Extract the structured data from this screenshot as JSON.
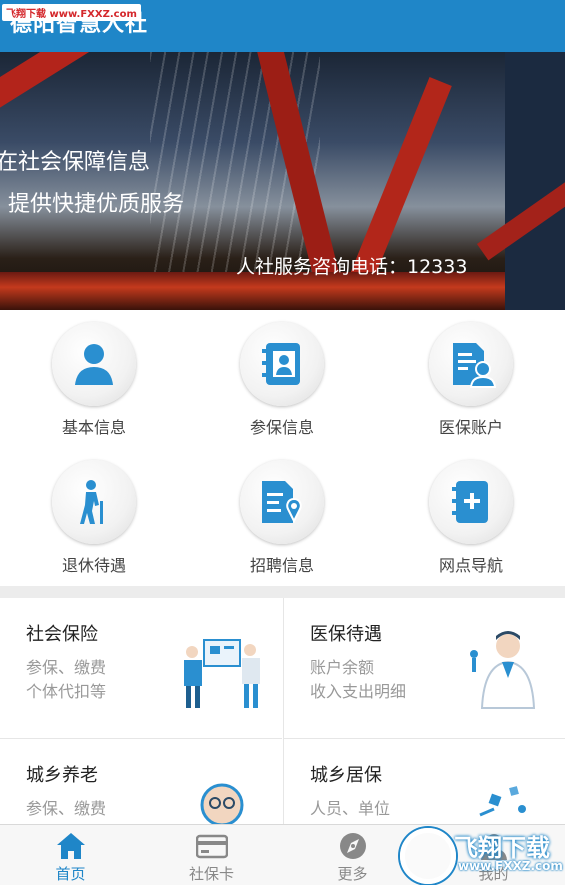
{
  "header": {
    "title": "德阳智慧人社",
    "watermark": "飞翔下载 www.FXXZ.com"
  },
  "banner": {
    "line1": "在社会保障信息",
    "line2": "提供快捷优质服务",
    "hotline": "人社服务咨询电话：12333"
  },
  "grid": [
    {
      "label": "基本信息",
      "icon": "person-icon"
    },
    {
      "label": "参保信息",
      "icon": "contact-book-icon"
    },
    {
      "label": "医保账户",
      "icon": "medical-account-icon"
    },
    {
      "label": "退休待遇",
      "icon": "elder-cane-icon"
    },
    {
      "label": "招聘信息",
      "icon": "document-location-icon"
    },
    {
      "label": "网点导航",
      "icon": "notebook-plus-icon"
    }
  ],
  "cards": [
    {
      "title": "社会保险",
      "sub1": "参保、缴费",
      "sub2": "个体代扣等"
    },
    {
      "title": "医保待遇",
      "sub1": "账户余额",
      "sub2": "收入支出明细"
    },
    {
      "title": "城乡养老",
      "sub1": "参保、缴费",
      "sub2": ""
    },
    {
      "title": "城乡居保",
      "sub1": "人员、单位",
      "sub2": ""
    }
  ],
  "tabs": [
    {
      "label": "首页",
      "icon": "home-icon"
    },
    {
      "label": "社保卡",
      "icon": "card-icon"
    },
    {
      "label": "更多",
      "icon": "compass-icon"
    },
    {
      "label": "我的",
      "icon": "user-icon"
    }
  ],
  "watermark_logo": {
    "brand": "飞翔下载",
    "url": "www.FXXZ.com"
  },
  "colors": {
    "accent": "#1f86c8",
    "icon_blue": "#2a8fd0",
    "tab_inactive": "#888888"
  }
}
